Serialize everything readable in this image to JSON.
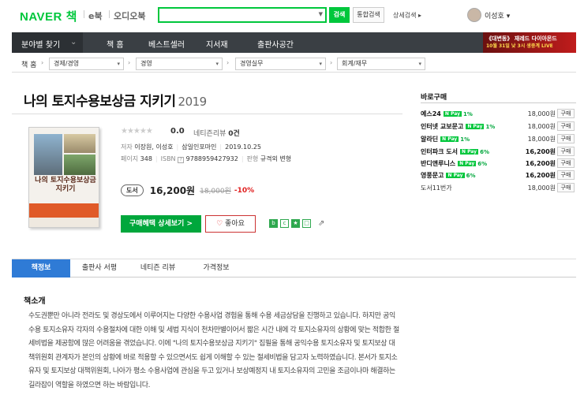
{
  "header": {
    "logo_naver": "NAVER",
    "logo_book": "책",
    "ebook": "e북",
    "audiobook": "오디오북",
    "search_placeholder": "",
    "search_button": "검색",
    "integrated_button": "통합검색",
    "detail_search": "상세검색 ▸",
    "username": "이성호 ▾"
  },
  "nav": {
    "category": "분야별 찾기",
    "items": [
      "책 홈",
      "베스트셀러",
      "지서재",
      "출판사공간"
    ],
    "ad_line1": "《대변동》 재레드 다이아몬드",
    "ad_line2": "10월 31일 낮 3시 생중계 LIVE"
  },
  "breadcrumb": {
    "home": "책 홈",
    "levels": [
      "경제/경영",
      "경영",
      "경영실무",
      "회계/재무"
    ]
  },
  "book": {
    "title": "나의 토지수용보상금 지키기",
    "year": "2019",
    "cover_title": "나의 토지수용보상금 지키기",
    "stars": "★★★★★",
    "score": "0.0",
    "review_label": "네티즌리뷰",
    "review_count": "0건",
    "author_label": "저자",
    "author": "이장원, 이성호",
    "publisher": "삼일인포마인",
    "date": "2019.10.25",
    "pages_label": "페이지",
    "pages": "348",
    "isbn_label": "ISBN",
    "isbn": "9788959427932",
    "edition_label": "판형",
    "edition": "규격외 변형",
    "format_tag": "도서",
    "price": "16,200원",
    "original_price": "18,000원",
    "discount": "-10%",
    "buy_button": "구매혜택 상세보기 >",
    "like_button": "좋아요"
  },
  "buy_panel": {
    "title": "바로구매",
    "stores": [
      {
        "name": "예스24",
        "npay": "N Pay",
        "pct": "1%",
        "price": "18,000원",
        "buy": "구매"
      },
      {
        "name": "인터넷 교보문고",
        "npay": "N Pay",
        "pct": "1%",
        "price": "18,000원",
        "buy": "구매"
      },
      {
        "name": "알라딘",
        "npay": "N Pay",
        "pct": "1%",
        "price": "18,000원",
        "buy": "구매"
      },
      {
        "name": "인터파크 도서",
        "npay": "N Pay",
        "pct": "6%",
        "price": "16,200원",
        "buy": "구매"
      },
      {
        "name": "반디앤루니스",
        "npay": "N Pay",
        "pct": "6%",
        "price": "16,200원",
        "buy": "구매"
      },
      {
        "name": "영풍문고",
        "npay": "N Pay",
        "pct": "6%",
        "price": "16,200원",
        "buy": "구매"
      },
      {
        "name": "도서11번가",
        "npay": "",
        "pct": "",
        "price": "18,000원",
        "buy": "구매"
      }
    ]
  },
  "tabs": [
    "책정보",
    "출판사 서평",
    "네티즌 리뷰",
    "가격정보"
  ],
  "intro": {
    "title": "책소개",
    "text": "수도권뿐만 아니라 전라도 및 경상도에서 이루어지는 다양한 수용사업 경험을 통해 수용 세금상담을 진행하고 있습니다. 하지만 공익수용 토지소유자 각자의 수용절차에 대한 이해 및 세법 지식이 천차만별이어서 짧은 시간 내에 각 토지소유자의 상황에 맞는 적합한 절세비법을 제공함에 많은 어려움을 겪었습니다. 이에 \"나의 토지수용보상금 지키기\" 집필을 통해 공익수용 토지소유자 및 토지보상 대책위원회 관계자가 본인의 상황에 바로 적용할 수 있으면서도 쉽게 이해할 수 있는 절세비법을 담고자 노력하였습니다. 본서가 토지소유자 및 토지보상 대책위원회, 나아가 평소 수용사업에 관심을 두고 있거나 보상예정지 내 토지소유자의 고민을 조금이나마 해결하는 길라잡이 역할을 하였으면 하는 바람입니다."
  }
}
